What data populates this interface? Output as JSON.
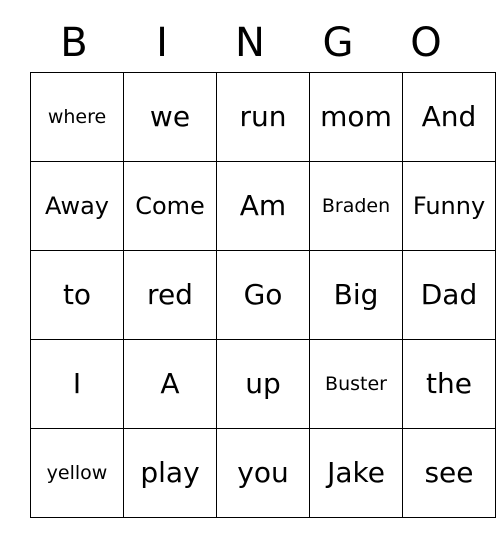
{
  "card": {
    "headers": [
      "B",
      "I",
      "N",
      "G",
      "O"
    ],
    "rows": [
      [
        {
          "text": "where",
          "size": "small"
        },
        {
          "text": "we",
          "size": "normal"
        },
        {
          "text": "run",
          "size": "normal"
        },
        {
          "text": "mom",
          "size": "normal"
        },
        {
          "text": "And",
          "size": "normal"
        }
      ],
      [
        {
          "text": "Away",
          "size": "medium"
        },
        {
          "text": "Come",
          "size": "medium"
        },
        {
          "text": "Am",
          "size": "normal"
        },
        {
          "text": "Braden",
          "size": "small"
        },
        {
          "text": "Funny",
          "size": "medium"
        }
      ],
      [
        {
          "text": "to",
          "size": "normal"
        },
        {
          "text": "red",
          "size": "normal"
        },
        {
          "text": "Go",
          "size": "normal"
        },
        {
          "text": "Big",
          "size": "normal"
        },
        {
          "text": "Dad",
          "size": "normal"
        }
      ],
      [
        {
          "text": "I",
          "size": "normal"
        },
        {
          "text": "A",
          "size": "normal"
        },
        {
          "text": "up",
          "size": "normal"
        },
        {
          "text": "Buster",
          "size": "small"
        },
        {
          "text": "the",
          "size": "normal"
        }
      ],
      [
        {
          "text": "yellow",
          "size": "small"
        },
        {
          "text": "play",
          "size": "normal"
        },
        {
          "text": "you",
          "size": "normal"
        },
        {
          "text": "Jake",
          "size": "normal"
        },
        {
          "text": "see",
          "size": "normal"
        }
      ]
    ]
  }
}
